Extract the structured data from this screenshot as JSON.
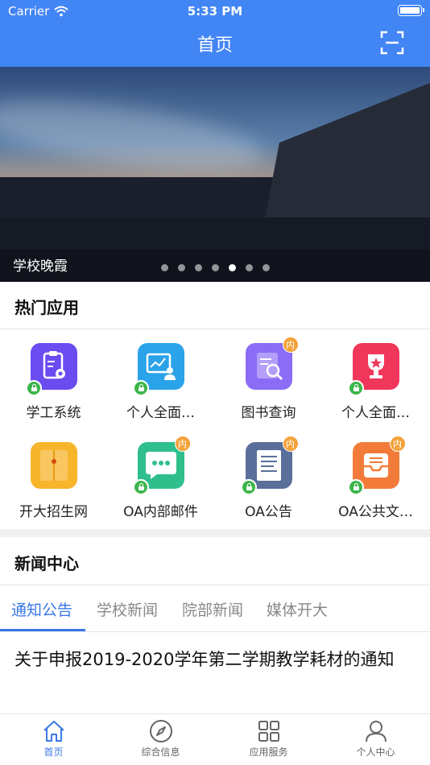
{
  "status_bar": {
    "carrier": "Carrier",
    "time": "5:33 PM"
  },
  "nav": {
    "title": "首页"
  },
  "banner": {
    "caption": "学校晚霞",
    "dot_count": 7,
    "active_dot": 4
  },
  "hot_apps": {
    "title": "热门应用",
    "items": [
      {
        "label": "学工系统",
        "icon": "clipboard-gear-icon",
        "color": "#6a4cf0",
        "locked": true,
        "badge": ""
      },
      {
        "label": "个人全面…",
        "icon": "chart-person-icon",
        "color": "#2aa3e8",
        "locked": true,
        "badge": ""
      },
      {
        "label": "图书查询",
        "icon": "book-search-icon",
        "color": "#8b6cf7",
        "locked": false,
        "badge": "内"
      },
      {
        "label": "个人全面…",
        "icon": "trophy-icon",
        "color": "#f0365a",
        "locked": true,
        "badge": ""
      },
      {
        "label": "开大招生网",
        "icon": "envelope-file-icon",
        "color": "#f7b52c",
        "locked": false,
        "badge": ""
      },
      {
        "label": "OA内部邮件",
        "icon": "chat-bubble-icon",
        "color": "#2fbf8c",
        "locked": true,
        "badge": "内"
      },
      {
        "label": "OA公告",
        "icon": "document-icon",
        "color": "#5a6f9a",
        "locked": true,
        "badge": "内"
      },
      {
        "label": "OA公共文…",
        "icon": "inbox-tray-icon",
        "color": "#f37b3a",
        "locked": true,
        "badge": "内"
      }
    ]
  },
  "news": {
    "title": "新闻中心",
    "tabs": [
      "通知公告",
      "学校新闻",
      "院部新闻",
      "媒体开大"
    ],
    "active_tab": 0,
    "first_item": "关于申报2019-2020学年第二学期教学耗材的通知"
  },
  "tabbar": {
    "items": [
      {
        "label": "首页",
        "icon": "home-icon"
      },
      {
        "label": "综合信息",
        "icon": "compass-icon"
      },
      {
        "label": "应用服务",
        "icon": "grid-icon"
      },
      {
        "label": "个人中心",
        "icon": "person-icon"
      }
    ],
    "active": 0
  },
  "colors": {
    "primary": "#4285f4",
    "accent": "#3a77e8",
    "lock": "#3db54a",
    "badge": "#f4a23a"
  }
}
